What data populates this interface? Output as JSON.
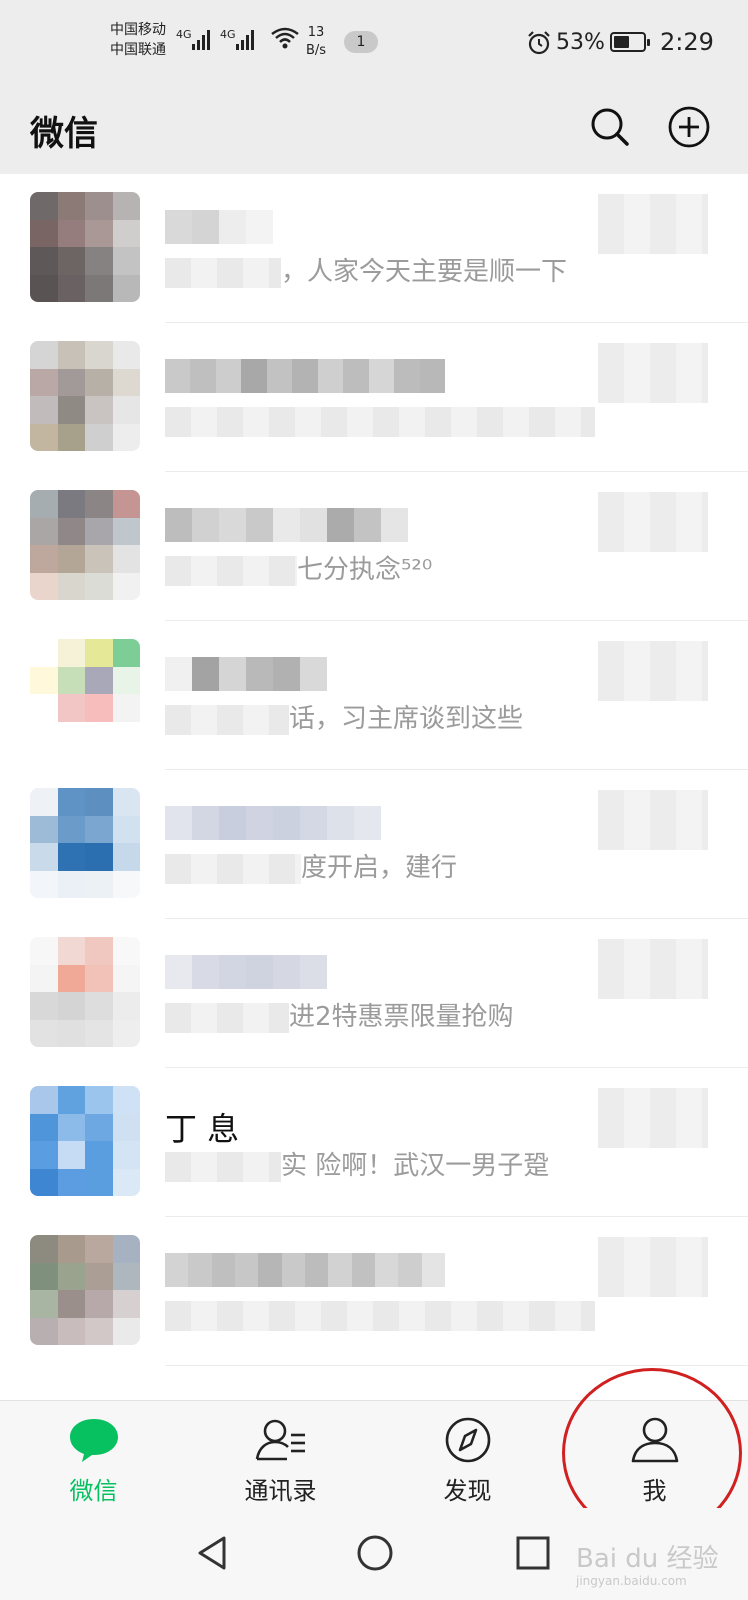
{
  "status_bar": {
    "carrier_1": "中国移动",
    "carrier_2": "中国联通",
    "network_1": "4G",
    "network_2": "4G",
    "speed_value": "13",
    "speed_unit": "B/s",
    "notification_count": "1",
    "battery": "53%",
    "battery_level": 0.53,
    "time": "2:29"
  },
  "header": {
    "title": "微信",
    "search_icon": "search-icon",
    "add_icon": "plus-circle-icon"
  },
  "chats": [
    {
      "name": "",
      "preview": "，人家今天主要是顺一下"
    },
    {
      "name": "",
      "preview": ""
    },
    {
      "name": "",
      "preview": "七分执念⁵²⁰"
    },
    {
      "name": "",
      "preview": "话，习主席谈到这些"
    },
    {
      "name": "",
      "preview": "度开启，建行"
    },
    {
      "name": "",
      "preview": "进2特惠票限量抢购"
    },
    {
      "name": "丁 息",
      "preview": "实 险啊！武汉一男子跫"
    },
    {
      "name": "",
      "preview": ""
    }
  ],
  "nav": {
    "tabs": [
      {
        "label": "微信",
        "icon": "chat-bubble-icon",
        "active": true
      },
      {
        "label": "通讯录",
        "icon": "contacts-icon",
        "active": false
      },
      {
        "label": "发现",
        "icon": "compass-icon",
        "active": false
      },
      {
        "label": "我",
        "icon": "person-icon",
        "active": false
      }
    ]
  },
  "colors": {
    "accent": "#07c160",
    "header_bg": "#ededed",
    "annotation": "#d02020"
  },
  "watermark": {
    "brand": "Bai du 经验",
    "url": "jingyan.baidu.com"
  }
}
